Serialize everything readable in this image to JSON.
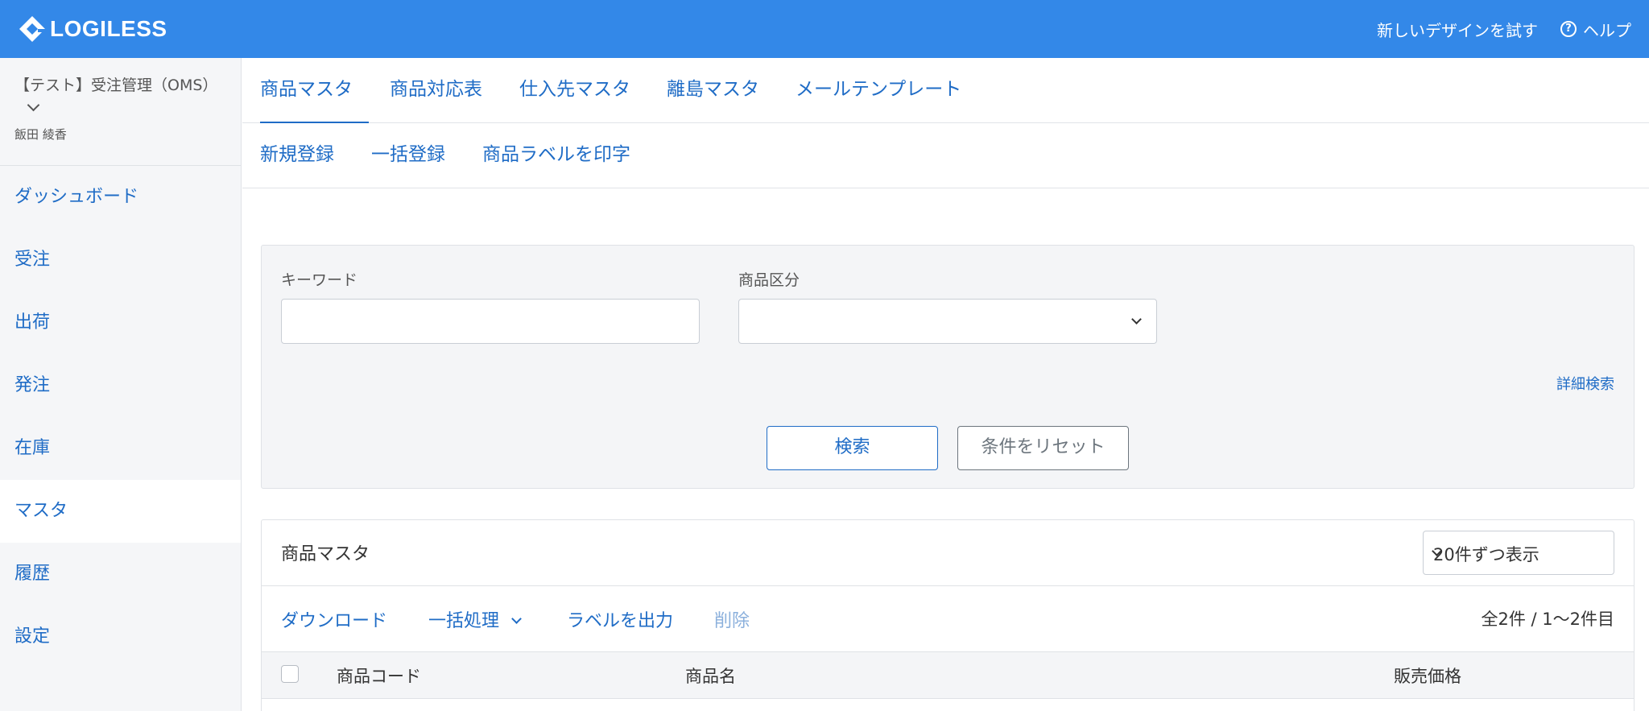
{
  "app": {
    "logo_text": "LOGILESS",
    "logo_icon": "logiless-diamond-icon"
  },
  "topbar": {
    "try_new_design": "新しいデザインを試す",
    "help_label": "ヘルプ",
    "help_icon": "question-circle-icon"
  },
  "sidebar": {
    "account_name": "【テスト】受注管理（OMS）",
    "user_name": "飯田 綾香",
    "items": [
      {
        "label": "ダッシュボード"
      },
      {
        "label": "受注"
      },
      {
        "label": "出荷"
      },
      {
        "label": "発注"
      },
      {
        "label": "在庫"
      },
      {
        "label": "マスタ"
      },
      {
        "label": "履歴"
      },
      {
        "label": "設定"
      }
    ]
  },
  "tabs": [
    {
      "label": "商品マスタ"
    },
    {
      "label": "商品対応表"
    },
    {
      "label": "仕入先マスタ"
    },
    {
      "label": "離島マスタ"
    },
    {
      "label": "メールテンプレート"
    }
  ],
  "subtabs": [
    {
      "label": "新規登録"
    },
    {
      "label": "一括登録"
    },
    {
      "label": "商品ラベルを印字"
    }
  ],
  "search": {
    "keyword_label": "キーワード",
    "keyword_value": "",
    "category_label": "商品区分",
    "category_value": "",
    "detail_link": "詳細検索",
    "search_button": "検索",
    "reset_button": "条件をリセット"
  },
  "list": {
    "title": "商品マスタ",
    "per_page": "20件ずつ表示",
    "toolbar": {
      "download": "ダウンロード",
      "bulk": "一括処理",
      "label_output": "ラベルを出力",
      "delete": "削除"
    },
    "count": "全2件 / 1〜2件目",
    "columns": [
      "商品コード",
      "商品名",
      "販売価格"
    ]
  }
}
